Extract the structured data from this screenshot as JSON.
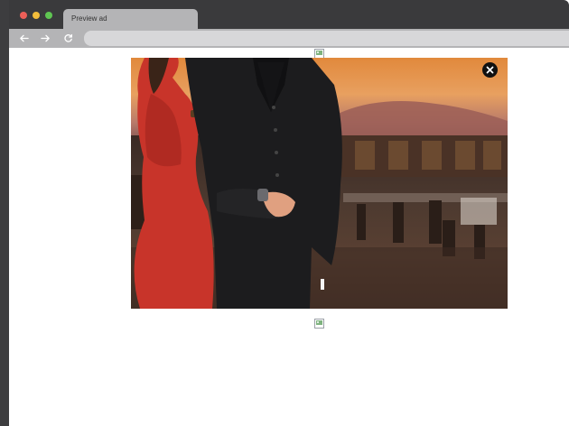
{
  "browser": {
    "tab_title": "Preview ad",
    "address": ""
  },
  "icons": {
    "back": "arrow-left-icon",
    "forward": "arrow-right-icon",
    "reload": "reload-icon",
    "close": "close-icon"
  },
  "colors": {
    "titlebar": "#3a3a3c",
    "toolbar": "#b4b4b6",
    "address_bar": "#d7d7d9",
    "close_button": "#111111"
  }
}
